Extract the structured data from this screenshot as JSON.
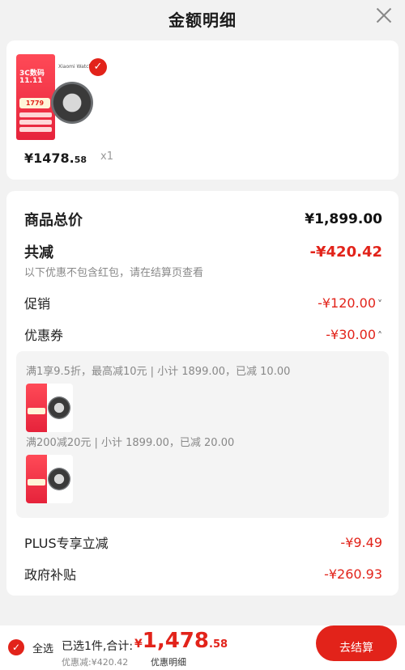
{
  "header": {
    "title": "金额明细"
  },
  "product": {
    "promo_line1": "3C数码",
    "promo_line2": "11.11",
    "promo_price": "1779",
    "brand": "Xiaomi Watch",
    "price_main": "¥1478.",
    "price_decimal": "58",
    "quantity": "x1"
  },
  "detail": {
    "total_label": "商品总价",
    "total_value": "¥1,899.00",
    "reduce_label": "共减",
    "reduce_value": "-¥420.42",
    "reduce_note": "以下优惠不包含红包，请在结算页查看",
    "promo_label": "促销",
    "promo_value": "-¥120.00",
    "coupon_label": "优惠券",
    "coupon_value": "-¥30.00",
    "coupons": [
      {
        "text": "满1享9.5折，最高减10元 | 小计 1899.00，已减 10.00"
      },
      {
        "text": "满200减20元 | 小计 1899.00，已减 20.00"
      }
    ],
    "plus_label": "PLUS专享立减",
    "plus_value": "-¥9.49",
    "gov_label": "政府补贴",
    "gov_value": "-¥260.93"
  },
  "footer": {
    "select_all": "全选",
    "selected": "已选1件,合计:",
    "total_symbol": "¥",
    "total_main": "1,478",
    "total_decimal": ".58",
    "discount": "优惠减:¥420.42",
    "detail_link": "优惠明细",
    "pay_label": "去结算"
  }
}
